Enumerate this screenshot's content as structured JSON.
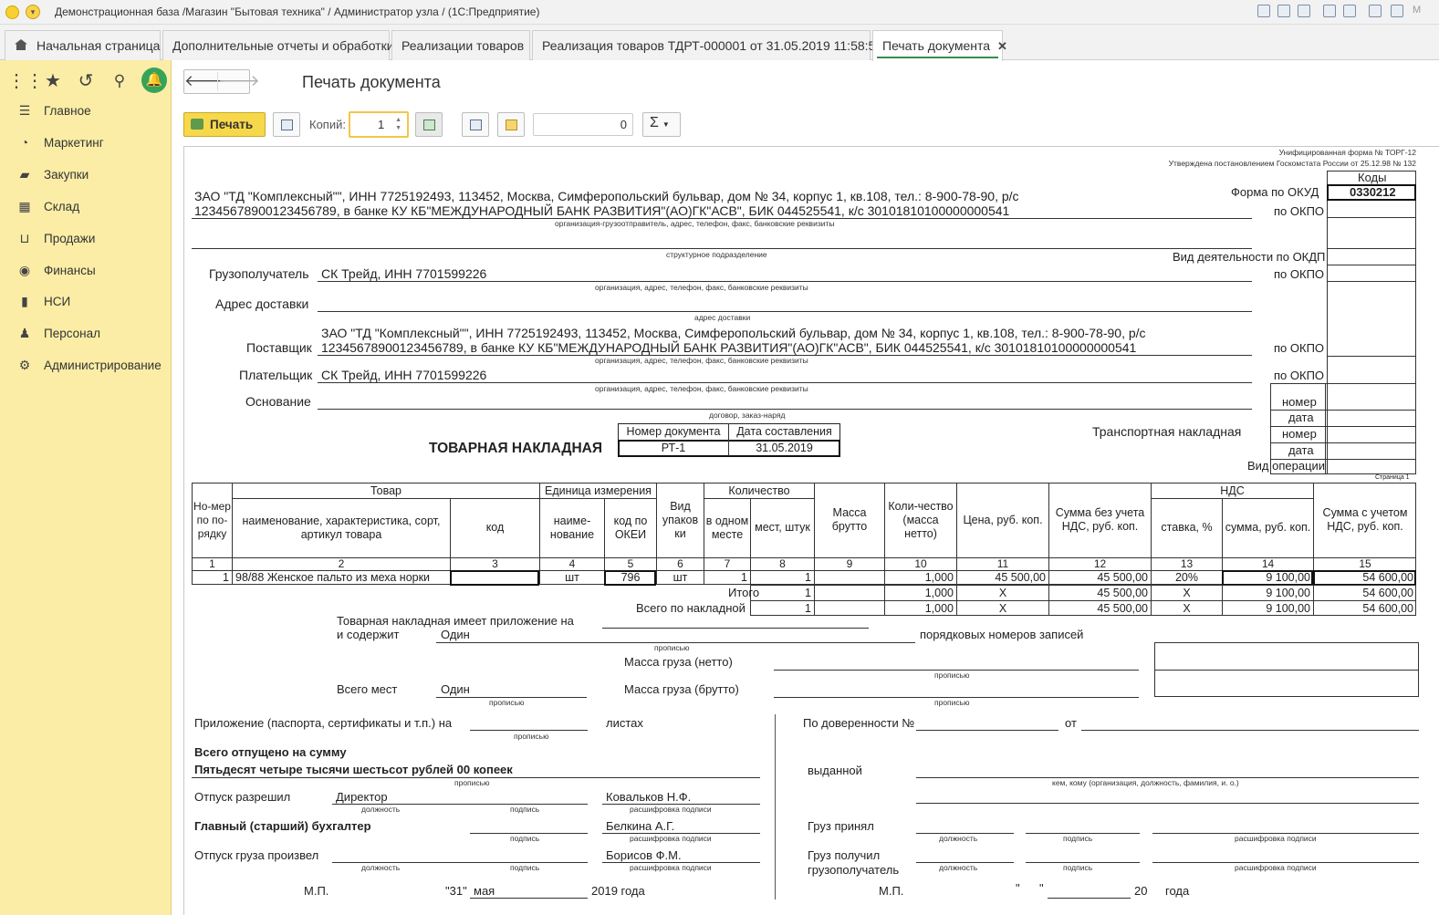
{
  "window": {
    "title": "Демонстрационная база /Магазин \"Бытовая техника\" / Администратор узла / (1С:Предприятие)"
  },
  "tabs": [
    {
      "label": "Начальная страница"
    },
    {
      "label": "Дополнительные отчеты и обработки"
    },
    {
      "label": "Реализации товаров"
    },
    {
      "label": "Реализация товаров ТДРТ-000001 от 31.05.2019 11:58:51"
    },
    {
      "label": "Печать документа"
    }
  ],
  "sidebar": {
    "items": [
      {
        "label": "Главное",
        "icon": "menu-lines-icon"
      },
      {
        "label": "Маркетинг",
        "icon": "pie-chart-icon"
      },
      {
        "label": "Закупки",
        "icon": "truck-icon"
      },
      {
        "label": "Склад",
        "icon": "warehouse-icon"
      },
      {
        "label": "Продажи",
        "icon": "basket-icon"
      },
      {
        "label": "Финансы",
        "icon": "coin-icon"
      },
      {
        "label": "НСИ",
        "icon": "book-icon"
      },
      {
        "label": "Персонал",
        "icon": "person-icon"
      },
      {
        "label": "Администрирование",
        "icon": "gear-icon"
      }
    ]
  },
  "page": {
    "title": "Печать документа"
  },
  "toolbar": {
    "print_label": "Печать",
    "copies_label": "Копий:",
    "copies_value": "1",
    "sum_value": "0",
    "sigma": "Σ"
  },
  "doc": {
    "form_header1": "Унифицированная форма № ТОРГ-12",
    "form_header2": "Утверждена постановлением Госкомстата России от 25.12.98 № 132",
    "codes_label": "Коды",
    "okud_label": "Форма по ОКУД",
    "okud_value": "0330212",
    "okpo": "по ОКПО",
    "okdp": "Вид деятельности по ОКДП",
    "shipper_line1": "ЗАО \"ТД \"Комплексный\"\", ИНН 7725192493, 113452, Москва, Симферопольский бульвар, дом № 34, корпус 1, кв.108, тел.: 8-900-78-90, р/с",
    "shipper_line2": "12345678900123456789, в банке КУ КБ\"МЕЖДУНАРОДНЫЙ БАНК РАЗВИТИЯ\"(АО)ГК\"АСВ\", БИК 044525541, к/с 30101810100000000541",
    "shipper_caption": "организация-грузоотправитель, адрес, телефон, факс, банковские реквизиты",
    "subdiv_caption": "структурное подразделение",
    "consignee_label": "Грузополучатель",
    "consignee_value": "СК Трейд, ИНН 7701599226",
    "org_caption": "организация, адрес, телефон, факс, банковские реквизиты",
    "delivery_label": "Адрес доставки",
    "delivery_caption": "адрес доставки",
    "supplier_label": "Поставщик",
    "payer_label": "Плательщик",
    "payer_value": "СК Трейд, ИНН 7701599226",
    "basis_label": "Основание",
    "basis_caption": "договор, заказ-наряд",
    "nomer": "номер",
    "data": "дата",
    "transport": "Транспортная накладная",
    "vid_oper": "Вид операции",
    "title": "ТОВАРНАЯ НАКЛАДНАЯ",
    "docnum_label": "Номер документа",
    "docdate_label": "Дата составления",
    "docnum": "РТ-1",
    "docdate": "31.05.2019",
    "page_label": "Страница 1"
  },
  "table": {
    "headers": {
      "num": "Но-мер по по-рядку",
      "tovar": "Товар",
      "name": "наименование, характеристика, сорт, артикул товара",
      "kod": "код",
      "unit": "Единица измерения",
      "unit_name": "наиме-нование",
      "okei": "код по ОКЕИ",
      "pack": "Вид упаков ки",
      "qty": "Количество",
      "in_place": "в одном месте",
      "places": "мест, штук",
      "gross": "Масса брутто",
      "net": "Коли-чество (масса нетто)",
      "price": "Цена, руб. коп.",
      "sum_no_vat": "Сумма без учета НДС, руб. коп.",
      "vat": "НДС",
      "rate": "ставка, %",
      "vat_sum": "сумма, руб. коп.",
      "total": "Сумма с учетом НДС, руб. коп."
    },
    "colnums": [
      "1",
      "2",
      "3",
      "4",
      "5",
      "6",
      "7",
      "8",
      "9",
      "10",
      "11",
      "12",
      "13",
      "14",
      "15"
    ],
    "row": [
      "1",
      "98/88 Женское пальто из меха норки",
      "",
      "шт",
      "796",
      "шт",
      "1",
      "1",
      "",
      "1,000",
      "45 500,00",
      "45 500,00",
      "20%",
      "9 100,00",
      "54 600,00"
    ],
    "itogo_label": "Итого",
    "vsego_label": "Всего по накладной",
    "itogo": [
      "1",
      "",
      "1,000",
      "X",
      "45 500,00",
      "X",
      "9 100,00",
      "54 600,00"
    ],
    "vsego": [
      "1",
      "",
      "1,000",
      "X",
      "45 500,00",
      "X",
      "9 100,00",
      "54 600,00"
    ]
  },
  "footer": {
    "pril1": "Товарная накладная имеет приложение на",
    "pril2": "и содержит",
    "records_value": "Один",
    "records_label": "порядковых номеров записей",
    "propis": "прописью",
    "mass_net": "Масса груза (нетто)",
    "mass_gross": "Масса груза (брутто)",
    "places_label": "Всего мест",
    "places_value": "Один",
    "docs_label": "Приложение (паспорта, сертификаты и т.п.) на",
    "sheets": "листах",
    "released_sum": "Всего отпущено  на сумму",
    "sum_words": "Пятьдесят четыре тысячи шестьсот рублей 00 копеек",
    "otpusk": "Отпуск разрешил",
    "director": "Директор",
    "kovalkov": "Ковальков Н.Ф.",
    "dolzh": "должность",
    "podpis": "подпись",
    "rasshifr": "расшифровка подписи",
    "buh": "Главный (старший) бухгалтер",
    "belkina": "Белкина А.Г.",
    "otpusk_gruza": "Отпуск груза произвел",
    "borisov": "Борисов Ф.М.",
    "mp": "М.П.",
    "day": "\"31\"",
    "month": "мая",
    "year": "2019 года",
    "doverennost": "По доверенности №",
    "ot": "от",
    "vydannoy": "выданной",
    "kem_komu": "кем, кому (организация, должность, фамилия, и. о.)",
    "gruz_prinyal": "Груз принял",
    "gruz_poluchil1": "Груз получил",
    "gruz_poluchil2": "грузополучатель",
    "mp2": "М.П.",
    "q1": "\"",
    "q2": "\"",
    "yr20": "20",
    "goda": "года"
  }
}
